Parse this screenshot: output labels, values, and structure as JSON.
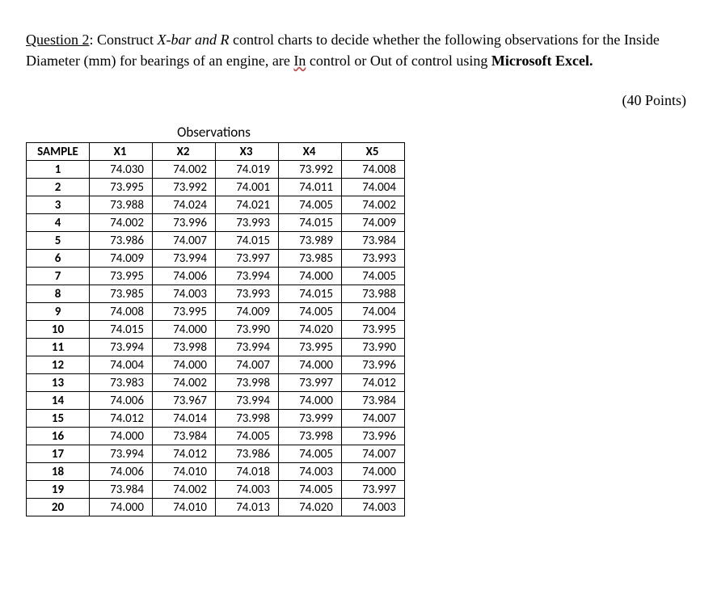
{
  "question": {
    "label": "Question 2",
    "text_parts": {
      "p1": ": Construct ",
      "italic1": "X-bar and R",
      "p2": " control charts to decide whether the following observations for the Inside Diameter (mm) for bearings of an engine, are ",
      "in_word": "In",
      "p3": " control or Out of control using ",
      "bold_end": "Microsoft Excel."
    }
  },
  "points": "(40 Points)",
  "table": {
    "obs_title": "Observations",
    "headers": {
      "sample": "SAMPLE",
      "x1": "X1",
      "x2": "X2",
      "x3": "X3",
      "x4": "X4",
      "x5": "X5"
    },
    "rows": [
      {
        "s": "1",
        "x1": "74.030",
        "x2": "74.002",
        "x3": "74.019",
        "x4": "73.992",
        "x5": "74.008"
      },
      {
        "s": "2",
        "x1": "73.995",
        "x2": "73.992",
        "x3": "74.001",
        "x4": "74.011",
        "x5": "74.004"
      },
      {
        "s": "3",
        "x1": "73.988",
        "x2": "74.024",
        "x3": "74.021",
        "x4": "74.005",
        "x5": "74.002"
      },
      {
        "s": "4",
        "x1": "74.002",
        "x2": "73.996",
        "x3": "73.993",
        "x4": "74.015",
        "x5": "74.009"
      },
      {
        "s": "5",
        "x1": "73.986",
        "x2": "74.007",
        "x3": "74.015",
        "x4": "73.989",
        "x5": "73.984"
      },
      {
        "s": "6",
        "x1": "74.009",
        "x2": "73.994",
        "x3": "73.997",
        "x4": "73.985",
        "x5": "73.993"
      },
      {
        "s": "7",
        "x1": "73.995",
        "x2": "74.006",
        "x3": "73.994",
        "x4": "74.000",
        "x5": "74.005"
      },
      {
        "s": "8",
        "x1": "73.985",
        "x2": "74.003",
        "x3": "73.993",
        "x4": "74.015",
        "x5": "73.988"
      },
      {
        "s": "9",
        "x1": "74.008",
        "x2": "73.995",
        "x3": "74.009",
        "x4": "74.005",
        "x5": "74.004"
      },
      {
        "s": "10",
        "x1": "74.015",
        "x2": "74.000",
        "x3": "73.990",
        "x4": "74.020",
        "x5": "73.995"
      },
      {
        "s": "11",
        "x1": "73.994",
        "x2": "73.998",
        "x3": "73.994",
        "x4": "73.995",
        "x5": "73.990"
      },
      {
        "s": "12",
        "x1": "74.004",
        "x2": "74.000",
        "x3": "74.007",
        "x4": "74.000",
        "x5": "73.996"
      },
      {
        "s": "13",
        "x1": "73.983",
        "x2": "74.002",
        "x3": "73.998",
        "x4": "73.997",
        "x5": "74.012"
      },
      {
        "s": "14",
        "x1": "74.006",
        "x2": "73.967",
        "x3": "73.994",
        "x4": "74.000",
        "x5": "73.984"
      },
      {
        "s": "15",
        "x1": "74.012",
        "x2": "74.014",
        "x3": "73.998",
        "x4": "73.999",
        "x5": "74.007"
      },
      {
        "s": "16",
        "x1": "74.000",
        "x2": "73.984",
        "x3": "74.005",
        "x4": "73.998",
        "x5": "73.996"
      },
      {
        "s": "17",
        "x1": "73.994",
        "x2": "74.012",
        "x3": "73.986",
        "x4": "74.005",
        "x5": "74.007"
      },
      {
        "s": "18",
        "x1": "74.006",
        "x2": "74.010",
        "x3": "74.018",
        "x4": "74.003",
        "x5": "74.000"
      },
      {
        "s": "19",
        "x1": "73.984",
        "x2": "74.002",
        "x3": "74.003",
        "x4": "74.005",
        "x5": "73.997"
      },
      {
        "s": "20",
        "x1": "74.000",
        "x2": "74.010",
        "x3": "74.013",
        "x4": "74.020",
        "x5": "74.003"
      }
    ]
  }
}
